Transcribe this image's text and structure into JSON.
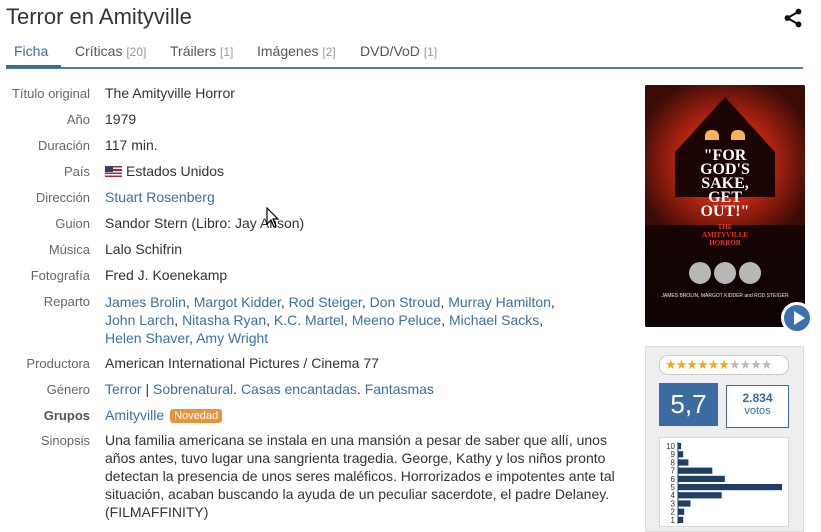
{
  "page": {
    "title": "Terror en Amityville"
  },
  "icons": {
    "share": "share-icon",
    "play": "play-icon",
    "cursor": "mouse-cursor"
  },
  "tabs": [
    {
      "label": "Ficha",
      "count": ""
    },
    {
      "label": "Críticas",
      "count": "[20]"
    },
    {
      "label": "Tráilers",
      "count": "[1]"
    },
    {
      "label": "Imágenes",
      "count": "[2]"
    },
    {
      "label": "DVD/VoD",
      "count": "[1]"
    }
  ],
  "info": {
    "original_title": {
      "label": "Título original",
      "value": "The Amityville Horror"
    },
    "year": {
      "label": "Año",
      "value": "1979"
    },
    "duration": {
      "label": "Duración",
      "value": "117 min."
    },
    "country": {
      "label": "País",
      "value": "Estados Unidos"
    },
    "director": {
      "label": "Dirección",
      "value": "Stuart Rosenberg"
    },
    "screenplay": {
      "label": "Guion",
      "value": "Sandor Stern (Libro: Jay Anson)"
    },
    "music": {
      "label": "Música",
      "value": "Lalo Schifrin"
    },
    "photography": {
      "label": "Fotografía",
      "value": "Fred J. Koenekamp"
    },
    "cast": {
      "label": "Reparto",
      "names": [
        "James Brolin",
        "Margot Kidder",
        "Rod Steiger",
        "Don Stroud",
        "Murray Hamilton",
        "John Larch",
        "Nitasha Ryan",
        "K.C. Martel",
        "Meeno Peluce",
        "Michael Sacks",
        "Helen Shaver",
        "Amy Wright"
      ]
    },
    "producer": {
      "label": "Productora",
      "value": "American International Pictures / Cinema 77"
    },
    "genre": {
      "label": "Género",
      "main": "Terror",
      "separator": "|",
      "topics": [
        "Sobrenatural",
        "Casas encantadas",
        "Fantasmas"
      ]
    },
    "groups": {
      "label": "Grupos",
      "value": "Amityville",
      "badge": "Novedad"
    },
    "synopsis": {
      "label": "Sinopsis",
      "text": "Una familia americana se instala en una mansión a pesar de saber que allí, unos años antes, tuvo lugar una sangrienta tragedia. George, Kathy y los niños pronto detectan la presencia de unos seres maléficos. Horrorizados e impotentes ante tal situación, acaban buscando la ayuda de un peculiar sacerdote, el padre Delaney. (FILMAFFINITY)"
    }
  },
  "poster": {
    "headline": [
      "\"FOR",
      "GOD'S",
      "SAKE,",
      "GET",
      "OUT!\""
    ],
    "film_title": [
      "THE",
      "AMITYVILLE",
      "HORROR"
    ],
    "credits": "JAMES BROLIN, MARGOT KIDDER and ROD STEIGER"
  },
  "rating": {
    "stars_filled": 5.7,
    "stars_total": 10,
    "average": "5,7",
    "votes_count": "2.834",
    "votes_label": "votos",
    "histogram": {
      "levels": [
        "10",
        "9",
        "8",
        "7",
        "6",
        "5",
        "4",
        "3",
        "2",
        "1"
      ],
      "shares": [
        0.03,
        0.05,
        0.1,
        0.33,
        0.45,
        1.0,
        0.42,
        0.12,
        0.06,
        0.05
      ]
    }
  },
  "colors": {
    "accent": "#3b6ba0",
    "link": "#3b6fa8",
    "badge": "#e8943a",
    "star": "#f2a91f"
  }
}
